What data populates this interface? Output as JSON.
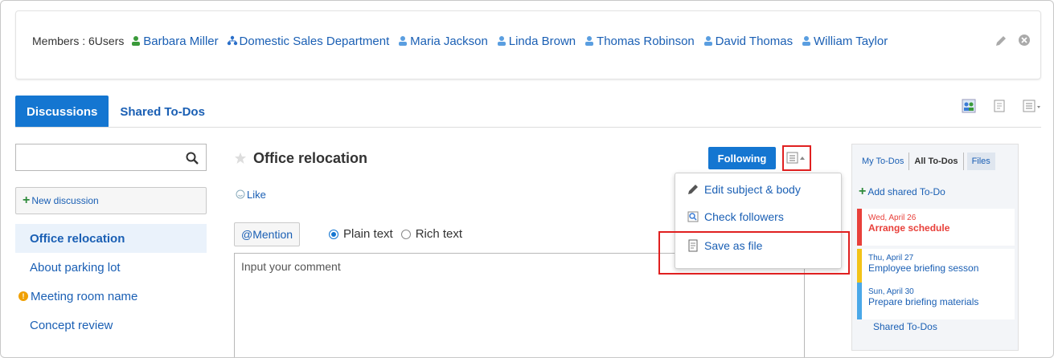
{
  "members": {
    "label": "Members : 6Users",
    "people": [
      {
        "name": "Barbara Miller",
        "kind": "user-green"
      },
      {
        "name": "Domestic Sales Department",
        "kind": "department"
      },
      {
        "name": "Maria Jackson",
        "kind": "user"
      },
      {
        "name": "Linda Brown",
        "kind": "user"
      },
      {
        "name": "Thomas Robinson",
        "kind": "user"
      },
      {
        "name": "David Thomas",
        "kind": "user"
      },
      {
        "name": "William Taylor",
        "kind": "user"
      }
    ]
  },
  "tabs": [
    {
      "label": "Discussions",
      "active": true
    },
    {
      "label": "Shared To-Dos",
      "active": false
    }
  ],
  "sidebar": {
    "search_placeholder": "",
    "new_discussion_label": "New discussion",
    "discussions": [
      {
        "label": "Office relocation",
        "active": true,
        "warning": false
      },
      {
        "label": "About parking lot",
        "active": false,
        "warning": false
      },
      {
        "label": "Meeting room name",
        "active": false,
        "warning": true
      },
      {
        "label": "Concept review",
        "active": false,
        "warning": false
      }
    ]
  },
  "main": {
    "title": "Office relocation",
    "following_label": "Following",
    "like_label": "Like",
    "mention_label": "@Mention",
    "plain_text_label": "Plain text",
    "rich_text_label": "Rich text",
    "comment_placeholder": "Input your comment"
  },
  "menu": {
    "items": [
      "Edit subject & body",
      "Check followers",
      "Save as file"
    ]
  },
  "todos_panel": {
    "tabs": [
      "My To-Dos",
      "All To-Dos",
      "Files"
    ],
    "add_label": "Add shared To-Do",
    "items": [
      {
        "date": "Wed, April 26",
        "name": "Arrange schedule",
        "color": "#e8403a"
      },
      {
        "date": "Thu, April 27",
        "name": "Employee briefing sesson",
        "color": "#f2c318"
      },
      {
        "date": "Sun, April 30",
        "name": "Prepare briefing materials",
        "color": "#4aa8e8"
      }
    ],
    "shared_link": "Shared To-Dos"
  },
  "colors": {
    "accent": "#1476d1",
    "link": "#1a5fb4",
    "highlight": "#e02020"
  }
}
